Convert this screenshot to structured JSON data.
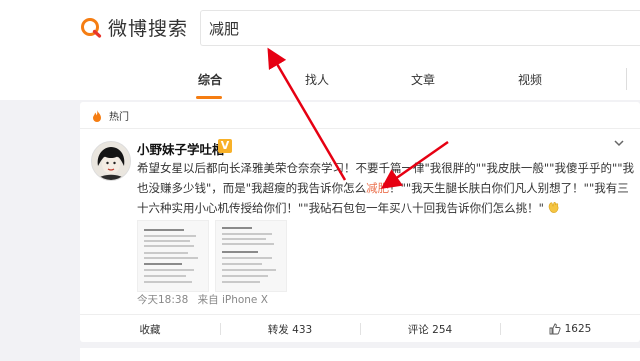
{
  "header": {
    "logo_text": "微博搜索",
    "search_value": "减肥"
  },
  "tabs": [
    {
      "label": "综合",
      "active": true
    },
    {
      "label": "找人",
      "active": false
    },
    {
      "label": "文章",
      "active": false
    },
    {
      "label": "视频",
      "active": false
    }
  ],
  "section": {
    "hot_label": "热门"
  },
  "post": {
    "username": "小野妹子学吐槽",
    "verified_badge": "V",
    "text_before": "希望女星以后都向长泽雅美荣仓奈奈学习！不要千篇一律\"我很胖的\"\"我皮肤一般\"\"我傻乎乎的\"\"我也没赚多少钱\"，而是\"我超瘦的我告诉你怎么",
    "text_highlight": "减肥",
    "text_after": "！\"\"我天生腿长肤白你们凡人别想了！\"\"我有三十六种实用小心机传授给你们！\"\"我砧石包包一年买八十回我告诉你们怎么挑！\"",
    "time": "今天18:38",
    "source_prefix": "来自",
    "source": "iPhone X"
  },
  "actions": {
    "collect": "收藏",
    "repost": "转发 433",
    "comment": "评论 254",
    "like": "1625"
  },
  "colors": {
    "accent": "#f57d12",
    "highlight": "#eb7350",
    "arrow": "#e60012"
  }
}
